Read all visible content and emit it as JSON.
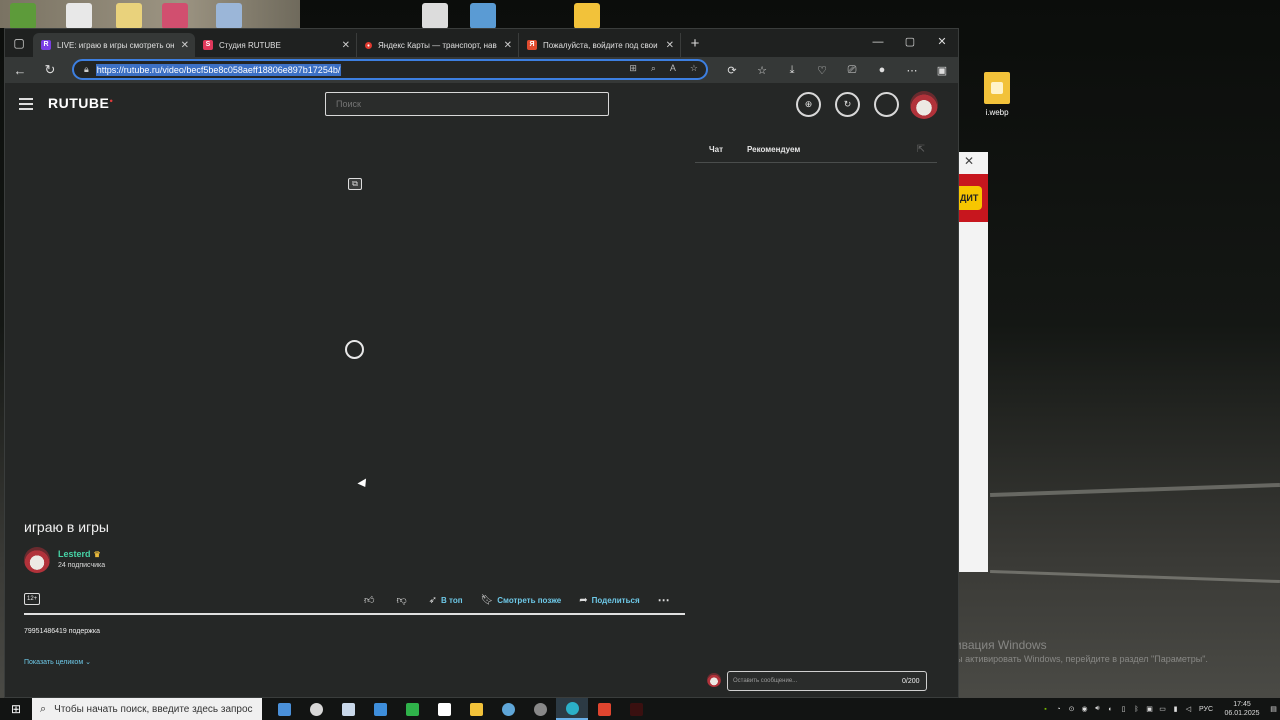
{
  "desktop": {
    "file_label": "i.webp",
    "background_window_button": "ДИТ",
    "watermark_title": "Активация Windows",
    "watermark_sub": "Чтобы активировать Windows, перейдите в раздел \"Параметры\"."
  },
  "browser": {
    "tabs": [
      {
        "title": "LIVE: играю в игры смотреть он",
        "favicon_color": "#7b3fe4",
        "favicon_letter": "R",
        "active": true
      },
      {
        "title": "Студия RUTUBE",
        "favicon_color": "#e0385b",
        "favicon_letter": "S",
        "active": false
      },
      {
        "title": "Яндекс Карты — транспорт, нав",
        "favicon_color": "#e03a2f",
        "favicon_letter": "•",
        "active": false
      },
      {
        "title": "Пожалуйста, войдите под свои",
        "favicon_color": "#e04b2f",
        "favicon_letter": "Я",
        "active": false
      }
    ],
    "url": "https://rutube.ru/video/becf5be8c058aeff18806e897b17254b/"
  },
  "rutube": {
    "logo": "RUTUBE",
    "search_placeholder": "Поиск",
    "side_tabs": {
      "chat": "Чат",
      "recommended": "Рекомендуем"
    },
    "video_title": "играю в игры",
    "channel_name": "Lesterd",
    "subscribers": "24 подписчика",
    "age_rating": "12+",
    "actions": {
      "top": "В топ",
      "watch_later": "Смотреть позже",
      "share": "Поделиться"
    },
    "description": "79951486419 подержка",
    "show_all": "Показать целиком",
    "chat_placeholder": "Оставить сообщение...",
    "chat_counter": "0/200"
  },
  "taskbar": {
    "search_placeholder": "Чтобы начать поиск, введите здесь запрос",
    "language": "РУС",
    "time": "17:45",
    "date": "06.01.2025"
  }
}
